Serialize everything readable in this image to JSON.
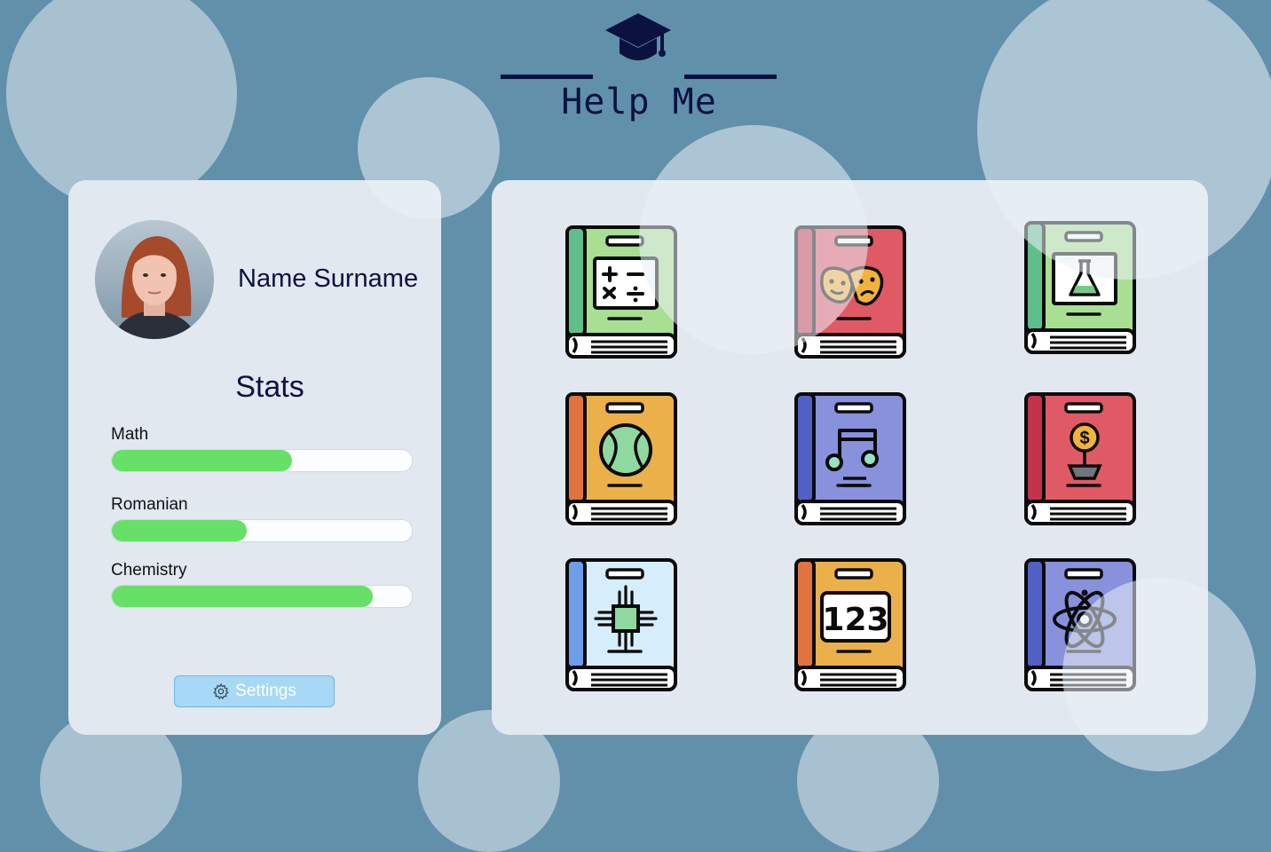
{
  "header": {
    "title": "Help Me",
    "icon": "graduation-cap-icon"
  },
  "profile": {
    "name": "Name Surname",
    "stats_title": "Stats"
  },
  "stats": [
    {
      "label": "Math",
      "value": 0.6
    },
    {
      "label": "Romanian",
      "value": 0.45
    },
    {
      "label": "Chemistry",
      "value": 0.87
    }
  ],
  "settings": {
    "label": "Settings",
    "icon": "gear-icon"
  },
  "subjects": [
    {
      "icon": "math-operations-book-icon",
      "cover": "#a8df92",
      "spine": "#5fbf8c"
    },
    {
      "icon": "theater-masks-book-icon",
      "cover": "#e05a66",
      "spine": "#c4334a"
    },
    {
      "icon": "flask-chemistry-book-icon",
      "cover": "#a8df92",
      "spine": "#5fbf8c"
    },
    {
      "icon": "globe-geography-book-icon",
      "cover": "#ecb04a",
      "spine": "#e0733e"
    },
    {
      "icon": "music-note-book-icon",
      "cover": "#8891dc",
      "spine": "#5060c5"
    },
    {
      "icon": "economics-money-plant-book-icon",
      "cover": "#e05a66",
      "spine": "#c4334a"
    },
    {
      "icon": "microchip-technology-book-icon",
      "cover": "#d6eefb",
      "spine": "#6e9dea"
    },
    {
      "icon": "numbers-123-book-icon",
      "cover": "#ecb04a",
      "spine": "#e0733e",
      "text": "123"
    },
    {
      "icon": "atom-physics-book-icon",
      "cover": "#8891dc",
      "spine": "#5060c5"
    }
  ],
  "colors": {
    "background": "#6190ab",
    "panel": "#e1e8ef",
    "accent_dark": "#0b1240",
    "progress": "#66e067"
  }
}
